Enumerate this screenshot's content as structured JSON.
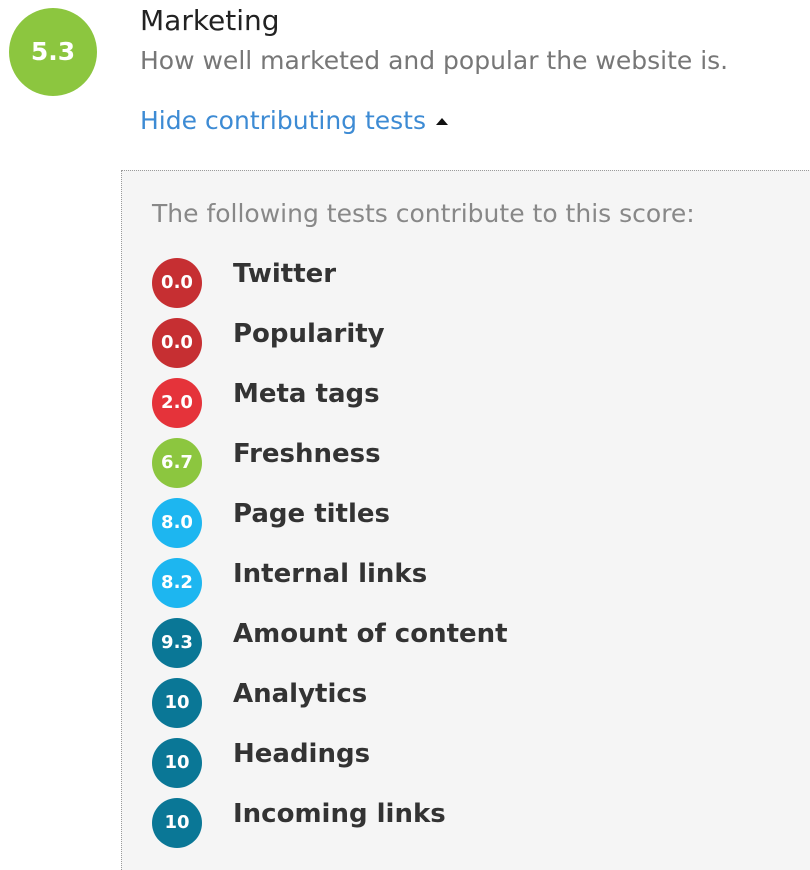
{
  "category": {
    "score": "5.3",
    "score_color": "#8cc63f",
    "title": "Marketing",
    "description": "How well marketed and popular the website is.",
    "toggle_label": "Hide contributing tests",
    "toggle_icon": "caret-up-icon"
  },
  "tests_panel": {
    "intro": "The following tests contribute to this score:",
    "tests": [
      {
        "score": "0.0",
        "name": "Twitter",
        "color": "#c62f32"
      },
      {
        "score": "0.0",
        "name": "Popularity",
        "color": "#c62f32"
      },
      {
        "score": "2.0",
        "name": "Meta tags",
        "color": "#e5333a"
      },
      {
        "score": "6.7",
        "name": "Freshness",
        "color": "#8cc63f"
      },
      {
        "score": "8.0",
        "name": "Page titles",
        "color": "#1db6f0"
      },
      {
        "score": "8.2",
        "name": "Internal links",
        "color": "#1db6f0"
      },
      {
        "score": "9.3",
        "name": "Amount of content",
        "color": "#0a7796"
      },
      {
        "score": "10",
        "name": "Analytics",
        "color": "#0a7796"
      },
      {
        "score": "10",
        "name": "Headings",
        "color": "#0a7796"
      },
      {
        "score": "10",
        "name": "Incoming links",
        "color": "#0a7796"
      }
    ]
  }
}
